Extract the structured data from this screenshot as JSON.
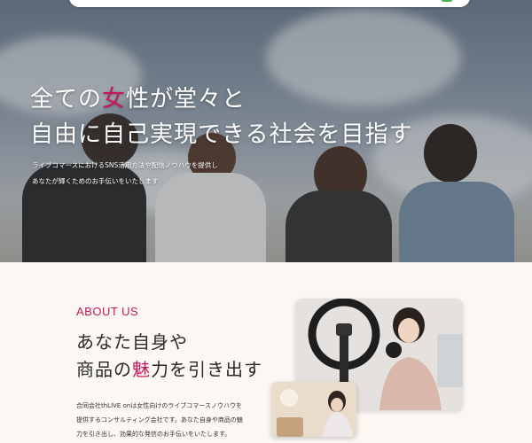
{
  "hero": {
    "title_line1_part1": "全ての",
    "title_line1_accent": "女",
    "title_line1_part2": "性が堂々と",
    "title_line2": "自由に自己実現できる社会を目指す",
    "subtitle_line1": "ライブコマースにおけるSNS活用方法や配信ノウハウを提供し",
    "subtitle_line2": "あなたが輝くためのお手伝いをいたします"
  },
  "about": {
    "label": "ABOUT US",
    "heading_line1": "あなた自身や",
    "heading_line2_part1": "商品の",
    "heading_line2_accent": "魅",
    "heading_line2_part2": "力を引き出す",
    "body_line1": "合同会社thLIVE onは女性向けのライブコマースノウハウを",
    "body_line2": "提供するコンサルティング会社です。あなた自身や商品の魅",
    "body_line3": "力を引き出し、効果的な発信のお手伝いをいたします。"
  },
  "colors": {
    "accent": "#c2185b",
    "background": "#fbf8f4"
  }
}
